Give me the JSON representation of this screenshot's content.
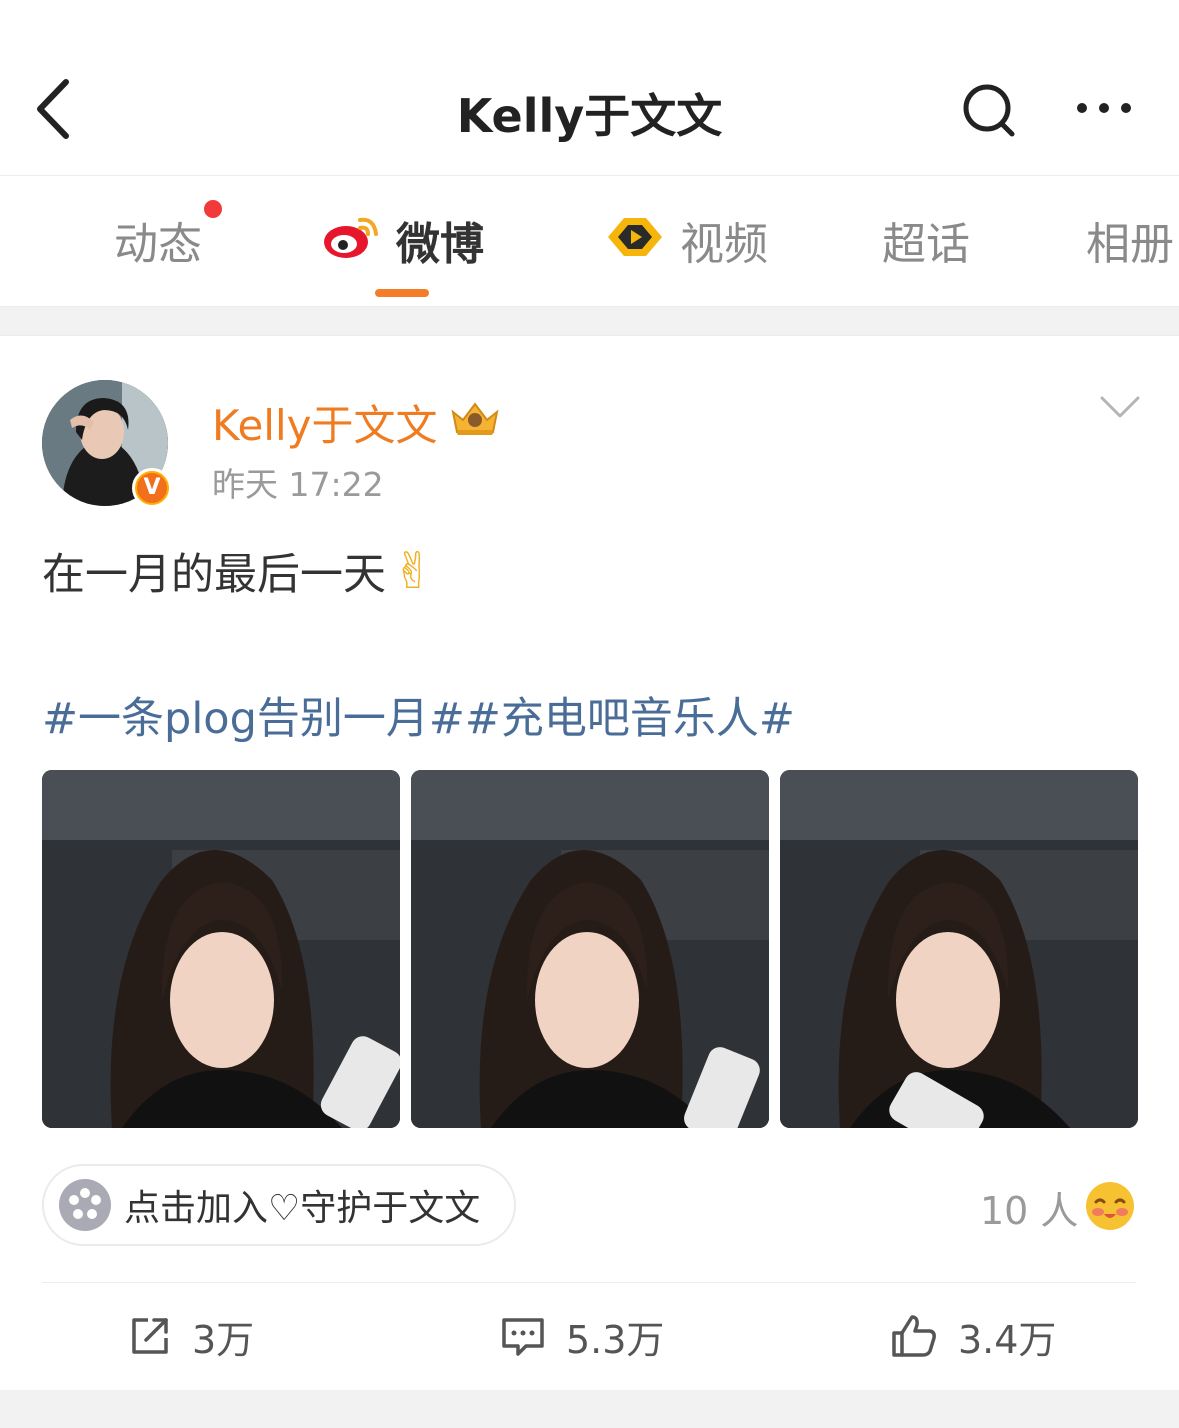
{
  "header": {
    "back_icon": "chevron-left-icon",
    "title": "Kelly于文文",
    "search_icon": "search-icon",
    "more_icon": "more-icon"
  },
  "tabs": [
    {
      "label": "动态",
      "has_dot": true
    },
    {
      "label": "微博",
      "active": true,
      "icon": "weibo-logo-icon"
    },
    {
      "label": "视频",
      "icon": "video-play-icon"
    },
    {
      "label": "超话"
    },
    {
      "label": "相册"
    }
  ],
  "post": {
    "author": "Kelly于文文",
    "verified_badge": "V",
    "time": "昨天 17:22",
    "text": "在一月的最后一天",
    "emoji": "✌",
    "hashtags": "#一条plog告别一月##充电吧音乐人#",
    "photos": [
      "photo-1",
      "photo-2",
      "photo-3"
    ],
    "join_label": "点击加入♡守护于文文",
    "people_count": "10 人"
  },
  "actions": {
    "repost_count": "3万",
    "comment_count": "5.3万",
    "like_count": "3.4万"
  },
  "colors": {
    "accent": "#f47d2a",
    "author": "#f07c22",
    "hashtag": "#4a6d98",
    "notify_dot": "#f23a3a"
  }
}
